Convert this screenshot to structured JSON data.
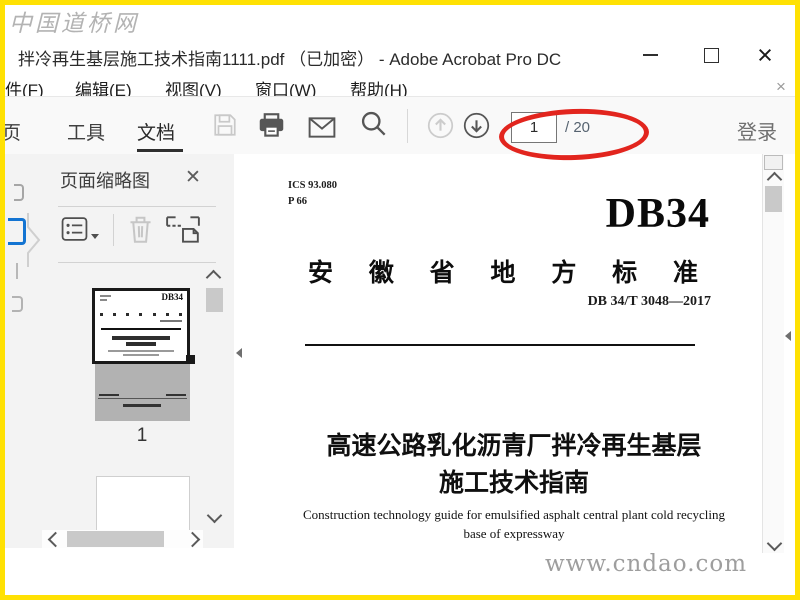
{
  "watermarks": {
    "top_left": "中国道桥网",
    "bottom_right": "www.cndao.com"
  },
  "titlebar": {
    "title": "拌冷再生基层施工技术指南1111.pdf （已加密） - Adobe Acrobat Pro DC",
    "close_glyph": "×"
  },
  "menubar": {
    "items": [
      "件(F)",
      "编辑(E)",
      "视图(V)",
      "窗口(W)",
      "帮助(H)"
    ],
    "close_glyph": "×"
  },
  "toolbar": {
    "tabs": [
      "页",
      "工具",
      "文档"
    ],
    "page_input_value": "1",
    "page_total": "/ 20",
    "login": "登录"
  },
  "sidebar": {
    "panel_title": "页面缩略图",
    "close_glyph": "✕",
    "page1_label": "1",
    "thumb_code": "DB34"
  },
  "document": {
    "ics": "ICS 93.080",
    "p_code": "P 66",
    "code": "DB34",
    "std_chars": [
      "安",
      "徽",
      "省",
      "地",
      "方",
      "标",
      "准"
    ],
    "std_no": "DB 34/T 3048—2017",
    "title1": "高速公路乳化沥青厂拌冷再生基层",
    "title2": "施工技术指南",
    "subtitle1": "Construction technology guide for emulsified asphalt central plant cold recycling",
    "subtitle2": "base of expressway"
  },
  "colors": {
    "annotation_red": "#e2251e",
    "frame_yellow": "#ffe103",
    "active_panel_blue": "#1374d2"
  }
}
